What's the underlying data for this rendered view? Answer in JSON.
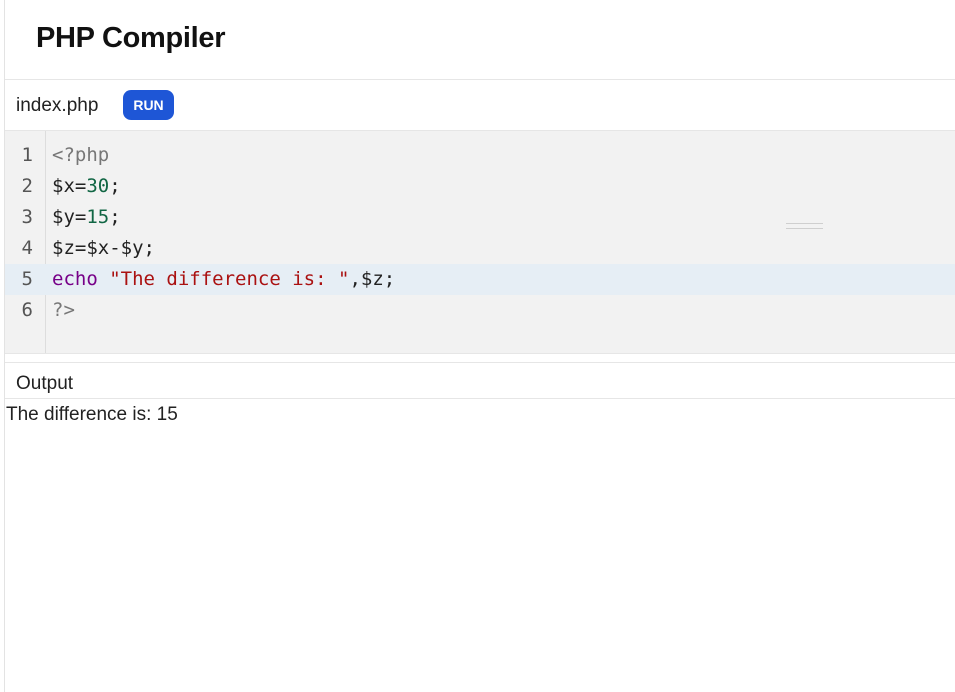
{
  "header": {
    "title": "PHP Compiler"
  },
  "tabbar": {
    "file_name": "index.php",
    "run_label": "RUN"
  },
  "editor": {
    "active_line": 5,
    "lines": [
      {
        "number": "1",
        "tokens": [
          {
            "type": "meta",
            "text": "<?php"
          }
        ]
      },
      {
        "number": "2",
        "tokens": [
          {
            "type": "plain",
            "text": "$x="
          },
          {
            "type": "number",
            "text": "30"
          },
          {
            "type": "plain",
            "text": ";"
          }
        ]
      },
      {
        "number": "3",
        "tokens": [
          {
            "type": "plain",
            "text": "$y="
          },
          {
            "type": "number",
            "text": "15"
          },
          {
            "type": "plain",
            "text": ";"
          }
        ]
      },
      {
        "number": "4",
        "tokens": [
          {
            "type": "plain",
            "text": "$z=$x-$y;"
          }
        ]
      },
      {
        "number": "5",
        "tokens": [
          {
            "type": "keyword",
            "text": "echo"
          },
          {
            "type": "plain",
            "text": " "
          },
          {
            "type": "string",
            "text": "\"The difference is: \""
          },
          {
            "type": "plain",
            "text": ",$z;"
          }
        ]
      },
      {
        "number": "6",
        "tokens": [
          {
            "type": "meta",
            "text": "?>"
          }
        ]
      }
    ]
  },
  "output": {
    "label": "Output",
    "text": "The difference is: 15"
  }
}
